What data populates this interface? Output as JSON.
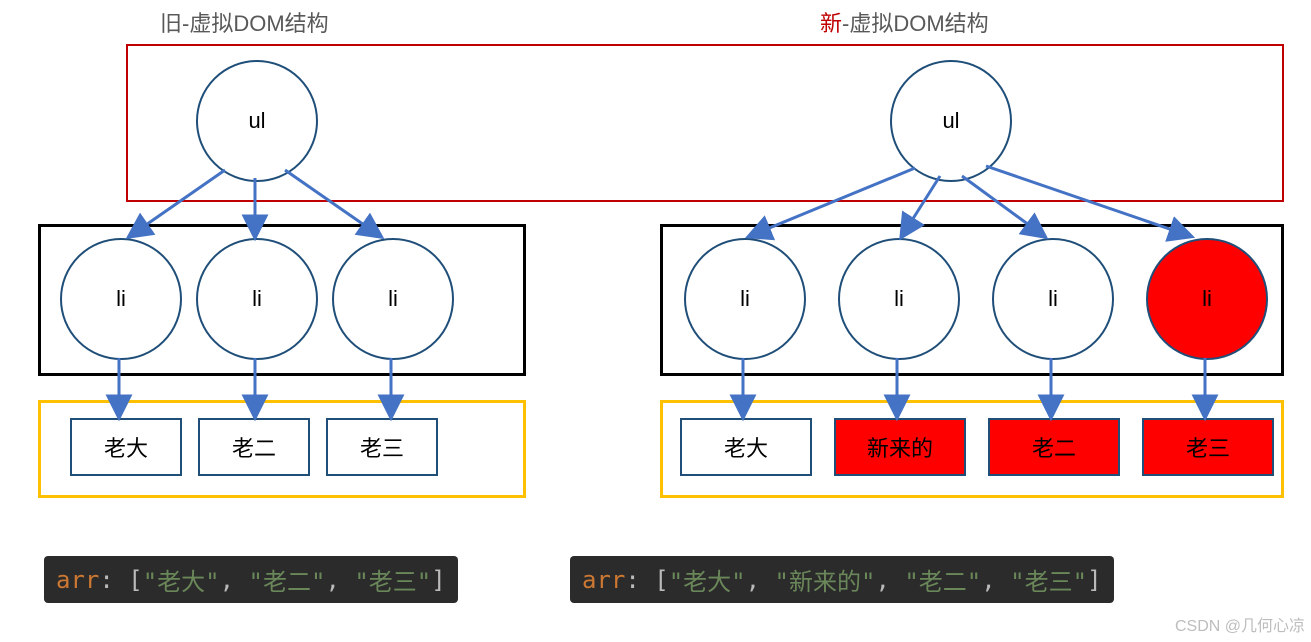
{
  "left": {
    "title_prefix": "旧",
    "title_rest": "-虚拟DOM结构",
    "ul_label": "ul",
    "li_labels": [
      "li",
      "li",
      "li"
    ],
    "items": [
      {
        "label": "老大",
        "red": false
      },
      {
        "label": "老二",
        "red": false
      },
      {
        "label": "老三",
        "red": false
      }
    ],
    "code": {
      "var": "arr",
      "sep": ": ",
      "open": "[",
      "items": [
        "老大",
        "老二",
        "老三"
      ],
      "close": "]"
    }
  },
  "right": {
    "title_prefix": "新",
    "title_rest": "-虚拟DOM结构",
    "ul_label": "ul",
    "li": [
      {
        "label": "li",
        "red": false
      },
      {
        "label": "li",
        "red": false
      },
      {
        "label": "li",
        "red": false
      },
      {
        "label": "li",
        "red": true
      }
    ],
    "items": [
      {
        "label": "老大",
        "red": false
      },
      {
        "label": "新来的",
        "red": true
      },
      {
        "label": "老二",
        "red": true
      },
      {
        "label": "老三",
        "red": true
      }
    ],
    "code": {
      "var": "arr",
      "sep": ": ",
      "open": "[",
      "items": [
        "老大",
        "新来的",
        "老二",
        "老三"
      ],
      "close": "]"
    }
  },
  "watermark": "CSDN @几何心凉"
}
